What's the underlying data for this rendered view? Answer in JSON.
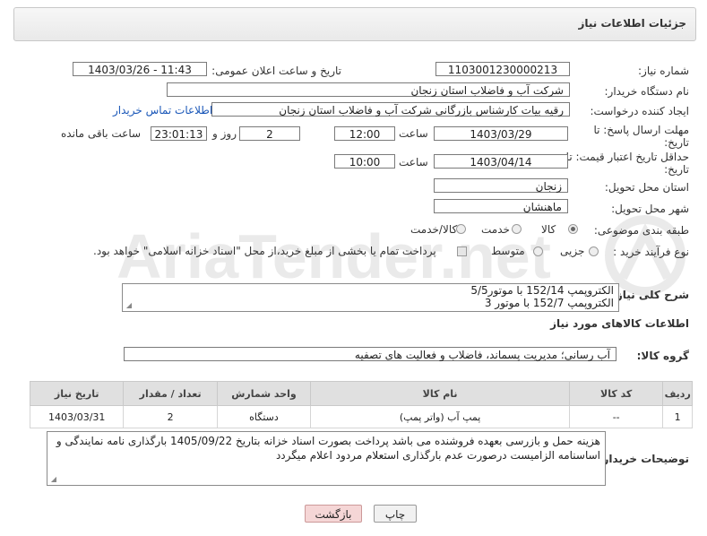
{
  "header": {
    "title": "جزئیات اطلاعات نیاز"
  },
  "form": {
    "need_number_label": "شماره نیاز:",
    "need_number": "1103001230000213",
    "announce_label": "تاریخ و ساعت اعلان عمومی:",
    "announce_value": "1403/03/26 - 11:43",
    "buyer_org_label": "نام دستگاه خریدار:",
    "buyer_org": "شرکت آب و فاضلاب استان زنجان",
    "creator_label": "ایجاد کننده درخواست:",
    "creator": "رقیه بیات کارشناس بازرگانی شرکت آب و فاضلاب استان زنجان",
    "buyer_contact_link": "اطلاعات تماس خریدار",
    "deadline_label_1": "مهلت ارسال پاسخ: تا",
    "deadline_label_2": "تاریخ:",
    "deadline_date": "1403/03/29",
    "time_label": "ساعت",
    "deadline_time": "12:00",
    "days_value": "2",
    "days_label": "روز و",
    "remaining_time": "23:01:13",
    "remaining_label": "ساعت باقی مانده",
    "validity_label_1": "حداقل تاریخ اعتبار قیمت: تا",
    "validity_label_2": "تاریخ:",
    "validity_date": "1403/04/14",
    "validity_time_label": "ساعت",
    "validity_time": "10:00",
    "province_label": "استان محل تحویل:",
    "province": "زنجان",
    "city_label": "شهر محل تحویل:",
    "city": "ماهنشان",
    "category_label": "طبقه بندی موضوعی:",
    "category_options": [
      "کالا",
      "خدمت",
      "کالا/خدمت"
    ],
    "process_label": "نوع فرآیند خرید :",
    "process_options": [
      "جزیی",
      "متوسط"
    ],
    "payment_note": "پرداخت تمام یا بخشی از مبلغ خرید،از محل \"اسناد خزانه اسلامی\" خواهد بود."
  },
  "description": {
    "label": "شرح کلی نیاز:",
    "line1": "الکتروپمپ 152/14 با موتور5/5",
    "line2": "الکتروپمپ 152/7 با موتور 3"
  },
  "goods_info": {
    "title": "اطلاعات کالاهای مورد نیاز",
    "group_label": "گروه کالا:",
    "group_value": "آب رسانی؛ مدیریت پسماند، فاضلاب و فعالیت های تصفیه"
  },
  "table": {
    "headers": [
      "ردیف",
      "کد کالا",
      "نام کالا",
      "واحد شمارش",
      "تعداد / مقدار",
      "تاریخ نیاز"
    ],
    "rows": [
      [
        "1",
        "--",
        "پمپ آب (واتر پمپ)",
        "دستگاه",
        "2",
        "1403/03/31"
      ]
    ]
  },
  "buyer_notes": {
    "label": "توضیحات خریدار:",
    "line1": "هزینه حمل و بازرسی بعهده فروشنده می باشد پرداخت بصورت اسناد خزانه بتاریخ 1405/09/22 بارگذاری نامه نمایندگی و",
    "line2": "اساسنامه الزامیست درصورت عدم بارگذاری استعلام مردود اعلام میگردد"
  },
  "buttons": {
    "print": "چاپ",
    "back": "بازگشت"
  },
  "watermark": {
    "text": "AriaTender.net"
  },
  "colors": {
    "link": "#1a57b8",
    "back_button_bg": "#f5d6d6",
    "header_bg": "#ececec"
  }
}
